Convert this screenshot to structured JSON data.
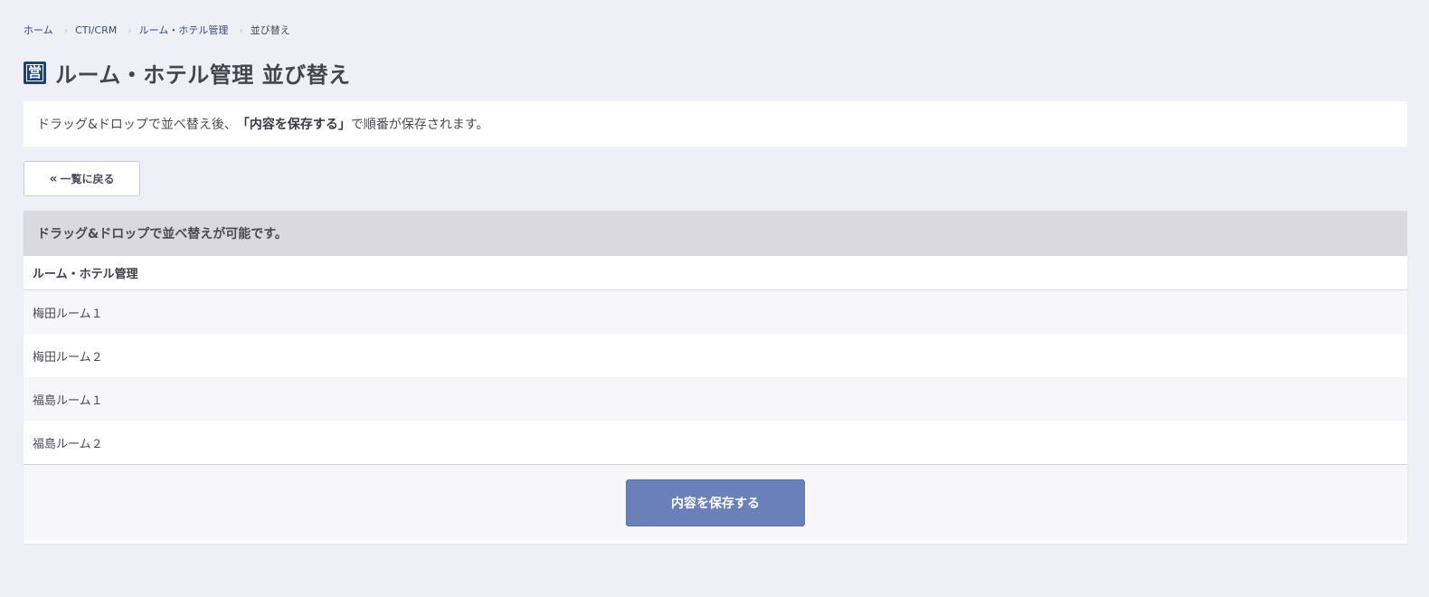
{
  "breadcrumb": [
    {
      "label": "ホーム"
    },
    {
      "label": "CTI/CRM"
    },
    {
      "label": "ルーム・ホテル管理"
    },
    {
      "label": "並び替え"
    }
  ],
  "title": {
    "icon_char": "営",
    "text": "ルーム・ホテル管理 並び替え"
  },
  "notice": {
    "before": "ドラッグ&ドロップで並べ替え後、",
    "emphasis": "「内容を保存する」",
    "after": "で順番が保存されます。"
  },
  "back_button": {
    "icon": "«",
    "label": "一覧に戻る"
  },
  "panel": {
    "header": "ドラッグ&ドロップで並べ替えが可能です。",
    "column_header": "ルーム・ホテル管理",
    "rows": [
      "梅田ルーム１",
      "梅田ルーム２",
      "福島ルーム１",
      "福島ルーム２"
    ],
    "save_label": "内容を保存する"
  },
  "colors": {
    "background": "#eff0f7",
    "title_icon": "#1d4470",
    "save_button": "#6a80b8",
    "panel_header": "#dad9e0"
  }
}
